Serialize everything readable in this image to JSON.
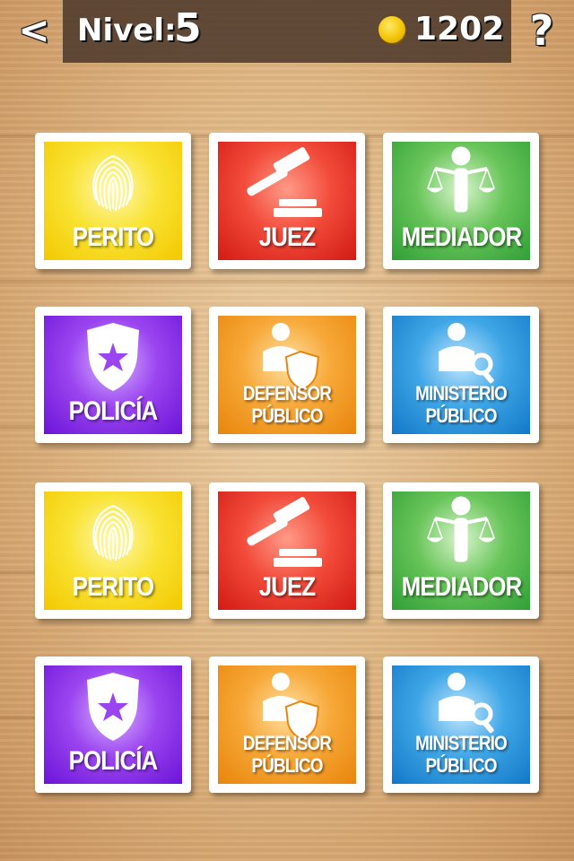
{
  "header": {
    "back_label": "<",
    "level_label": "Nivel:",
    "level_value": "5",
    "coins": "1202",
    "help_label": "?"
  },
  "cards": [
    {
      "label_1": "PERITO",
      "label_2": "",
      "icon": "fingerprint-icon",
      "color": "yellow"
    },
    {
      "label_1": "JUEZ",
      "label_2": "",
      "icon": "gavel-icon",
      "color": "red"
    },
    {
      "label_1": "MEDIADOR",
      "label_2": "",
      "icon": "scales-icon",
      "color": "green"
    },
    {
      "label_1": "POLICÍA",
      "label_2": "",
      "icon": "badge-icon",
      "color": "purple"
    },
    {
      "label_1": "DEFENSOR",
      "label_2": "PÚBLICO",
      "icon": "defender-icon",
      "color": "orange"
    },
    {
      "label_1": "MINISTERIO",
      "label_2": "PÚBLICO",
      "icon": "prosecutor-icon",
      "color": "blue"
    },
    {
      "label_1": "PERITO",
      "label_2": "",
      "icon": "fingerprint-icon",
      "color": "yellow"
    },
    {
      "label_1": "JUEZ",
      "label_2": "",
      "icon": "gavel-icon",
      "color": "red"
    },
    {
      "label_1": "MEDIADOR",
      "label_2": "",
      "icon": "scales-icon",
      "color": "green"
    },
    {
      "label_1": "POLICÍA",
      "label_2": "",
      "icon": "badge-icon",
      "color": "purple"
    },
    {
      "label_1": "DEFENSOR",
      "label_2": "PÚBLICO",
      "icon": "defender-icon",
      "color": "orange"
    },
    {
      "label_1": "MINISTERIO",
      "label_2": "PÚBLICO",
      "icon": "prosecutor-icon",
      "color": "blue"
    }
  ]
}
